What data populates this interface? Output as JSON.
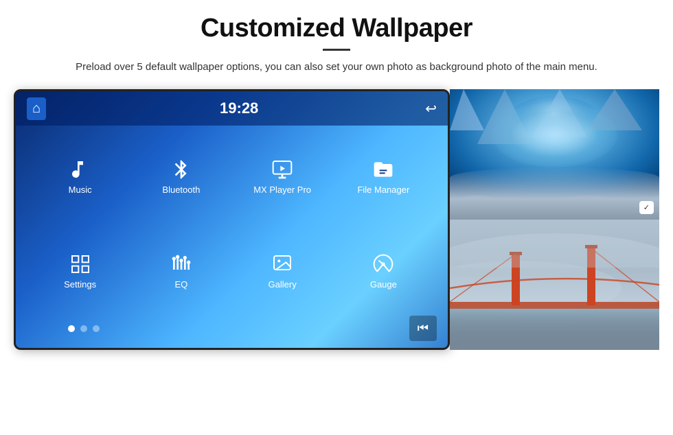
{
  "header": {
    "title": "Customized Wallpaper",
    "subtitle": "Preload over 5 default wallpaper options, you can also set your own photo as background photo of the main menu."
  },
  "screen": {
    "time": "19:28",
    "apps_row1": [
      {
        "label": "Music",
        "icon": "music"
      },
      {
        "label": "Bluetooth",
        "icon": "bluetooth"
      },
      {
        "label": "MX Player Pro",
        "icon": "video"
      },
      {
        "label": "File Manager",
        "icon": "folder"
      }
    ],
    "apps_row2": [
      {
        "label": "Settings",
        "icon": "settings"
      },
      {
        "label": "EQ",
        "icon": "eq"
      },
      {
        "label": "Gallery",
        "icon": "gallery"
      },
      {
        "label": "Gauge",
        "icon": "gauge"
      }
    ],
    "dots": [
      true,
      false,
      false
    ]
  },
  "photos": {
    "top_alt": "Ice cave blue photo",
    "bottom_alt": "Golden Gate Bridge fog photo",
    "badge_text": "✓"
  }
}
